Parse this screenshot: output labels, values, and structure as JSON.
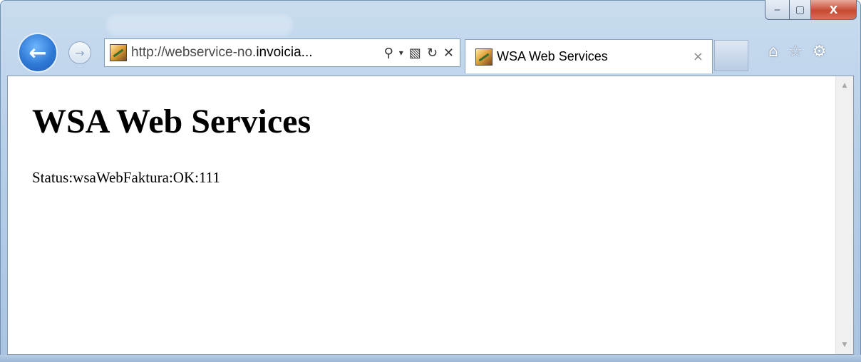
{
  "window": {
    "caption_buttons": {
      "minimize_icon": "minimize-icon",
      "maximize_icon": "maximize-icon",
      "close_icon": "close-icon",
      "minimize_glyph": "‒",
      "maximize_glyph": "▢",
      "close_glyph": "X"
    }
  },
  "nav": {
    "back_glyph": "←",
    "forward_glyph": "→"
  },
  "address_bar": {
    "url_prefix": "http://webservice-no.",
    "url_host": "invoicia...",
    "icons": {
      "search": "⚲",
      "dropdown": "▾",
      "compat": "▧",
      "refresh": "↻",
      "stop": "✕"
    }
  },
  "tab": {
    "label": "WSA Web Services",
    "close_glyph": "×"
  },
  "toolbar": {
    "home_glyph": "⌂",
    "favorites_glyph": "☆",
    "tools_glyph": "⚙"
  },
  "page": {
    "heading": "WSA Web Services",
    "status": "Status:wsaWebFaktura:OK:111"
  },
  "scrollbar": {
    "up_glyph": "▲",
    "down_glyph": "▼"
  }
}
